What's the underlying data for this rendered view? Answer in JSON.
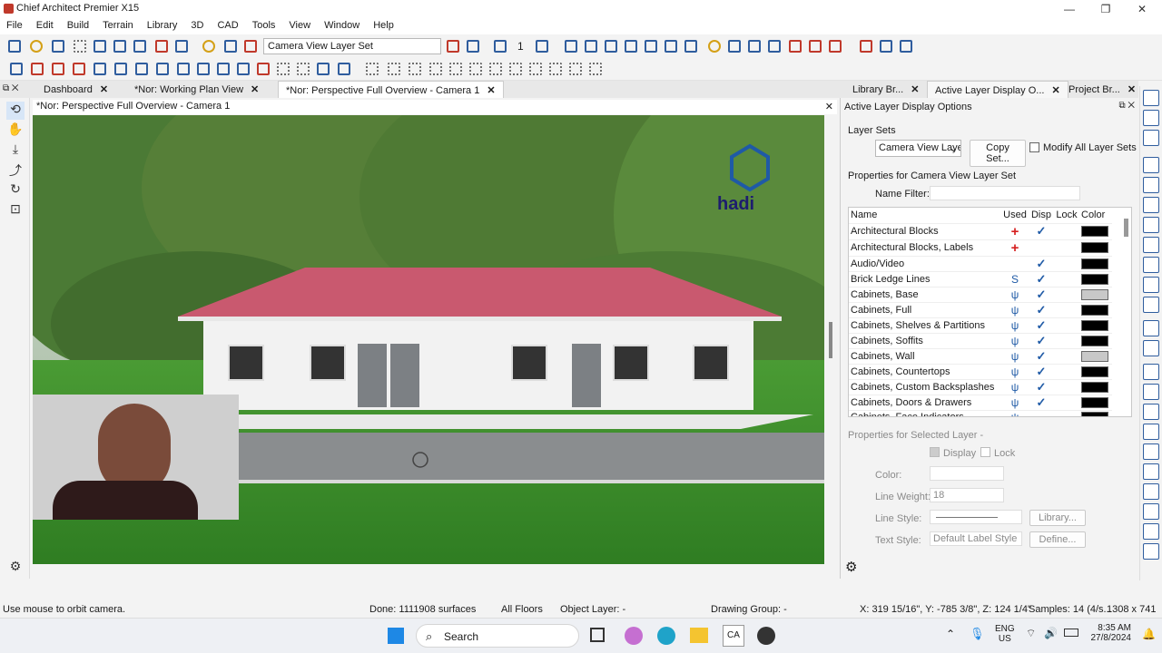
{
  "app": {
    "title": "Chief Architect Premier X15"
  },
  "menu": [
    "File",
    "Edit",
    "Build",
    "Terrain",
    "Library",
    "3D",
    "CAD",
    "Tools",
    "View",
    "Window",
    "Help"
  ],
  "toolbar": {
    "layer_set_select": "Camera View Layer Set",
    "floor_number": "1"
  },
  "tabs": [
    {
      "label": "Dashboard"
    },
    {
      "label": "*Nor: Working Plan View"
    },
    {
      "label": "*Nor: Perspective Full Overview - Camera 1"
    }
  ],
  "view": {
    "header": "*Nor: Perspective Full Overview - Camera 1",
    "watermark_text": "hadi"
  },
  "panel_tabs": [
    {
      "label": "Library Br..."
    },
    {
      "label": "Active Layer Display O..."
    },
    {
      "label": "Project Br..."
    }
  ],
  "panel": {
    "title": "Active Layer Display Options",
    "layer_sets_label": "Layer Sets",
    "layer_set_value": "Camera View Laye",
    "copy_set_label": "Copy Set...",
    "modify_all_label": "Modify All Layer Sets",
    "properties_label": "Properties for Camera View Layer Set",
    "name_filter_label": "Name Filter:",
    "columns": {
      "name": "Name",
      "used": "Used",
      "disp": "Disp",
      "lock": "Lock",
      "color": "Color"
    },
    "layers": [
      {
        "name": "Architectural Blocks",
        "used": "+",
        "disp": "✓",
        "color": "#000000"
      },
      {
        "name": "Architectural Blocks, Labels",
        "used": "+",
        "disp": "",
        "color": "#000000"
      },
      {
        "name": "Audio/Video",
        "used": "",
        "disp": "✓",
        "color": "#000000"
      },
      {
        "name": "Brick Ledge Lines",
        "used": "S",
        "disp": "✓",
        "color": "#000000"
      },
      {
        "name": "Cabinets,  Base",
        "used": "ψ",
        "disp": "✓",
        "color": "#c8c8c8"
      },
      {
        "name": "Cabinets,  Full",
        "used": "ψ",
        "disp": "✓",
        "color": "#000000"
      },
      {
        "name": "Cabinets,  Shelves & Partitions",
        "used": "ψ",
        "disp": "✓",
        "color": "#000000"
      },
      {
        "name": "Cabinets,  Soffits",
        "used": "ψ",
        "disp": "✓",
        "color": "#000000"
      },
      {
        "name": "Cabinets,  Wall",
        "used": "ψ",
        "disp": "✓",
        "color": "#c8c8c8"
      },
      {
        "name": "Cabinets, Countertops",
        "used": "ψ",
        "disp": "✓",
        "color": "#000000"
      },
      {
        "name": "Cabinets, Custom Backsplashes",
        "used": "ψ",
        "disp": "✓",
        "color": "#000000"
      },
      {
        "name": "Cabinets, Doors & Drawers",
        "used": "ψ",
        "disp": "✓",
        "color": "#000000"
      },
      {
        "name": "Cabinets, Face Indicators",
        "used": "ψ",
        "disp": "",
        "color": "#000000"
      }
    ],
    "selected_label": "Properties for Selected Layer -",
    "display_label": "Display",
    "lock_label": "Lock",
    "color_label": "Color:",
    "line_weight_label": "Line Weight:",
    "line_weight_value": "18",
    "line_style_label": "Line Style:",
    "library_btn": "Library...",
    "text_style_label": "Text Style:",
    "text_style_value": "Default Label Style",
    "define_btn": "Define..."
  },
  "status": {
    "hint": "Use mouse to orbit camera.",
    "done": "Done:  1111908 surfaces",
    "floors": "All Floors",
    "object_layer": "Object Layer: -",
    "drawing_group": "Drawing Group: -",
    "coords": "X: 319 15/16\", Y: -785 3/8\", Z: 124 1/4\"",
    "samples": "Samples: 14 (4/s...",
    "size": "1308 x 741"
  },
  "taskbar": {
    "search": "Search",
    "lang1": "ENG",
    "lang2": "US",
    "time": "8:35 AM",
    "date": "27/8/2024"
  },
  "colors": {
    "roof": "#c9596f",
    "accent": "#2f5d9e",
    "grass": "#3f8f2e"
  }
}
